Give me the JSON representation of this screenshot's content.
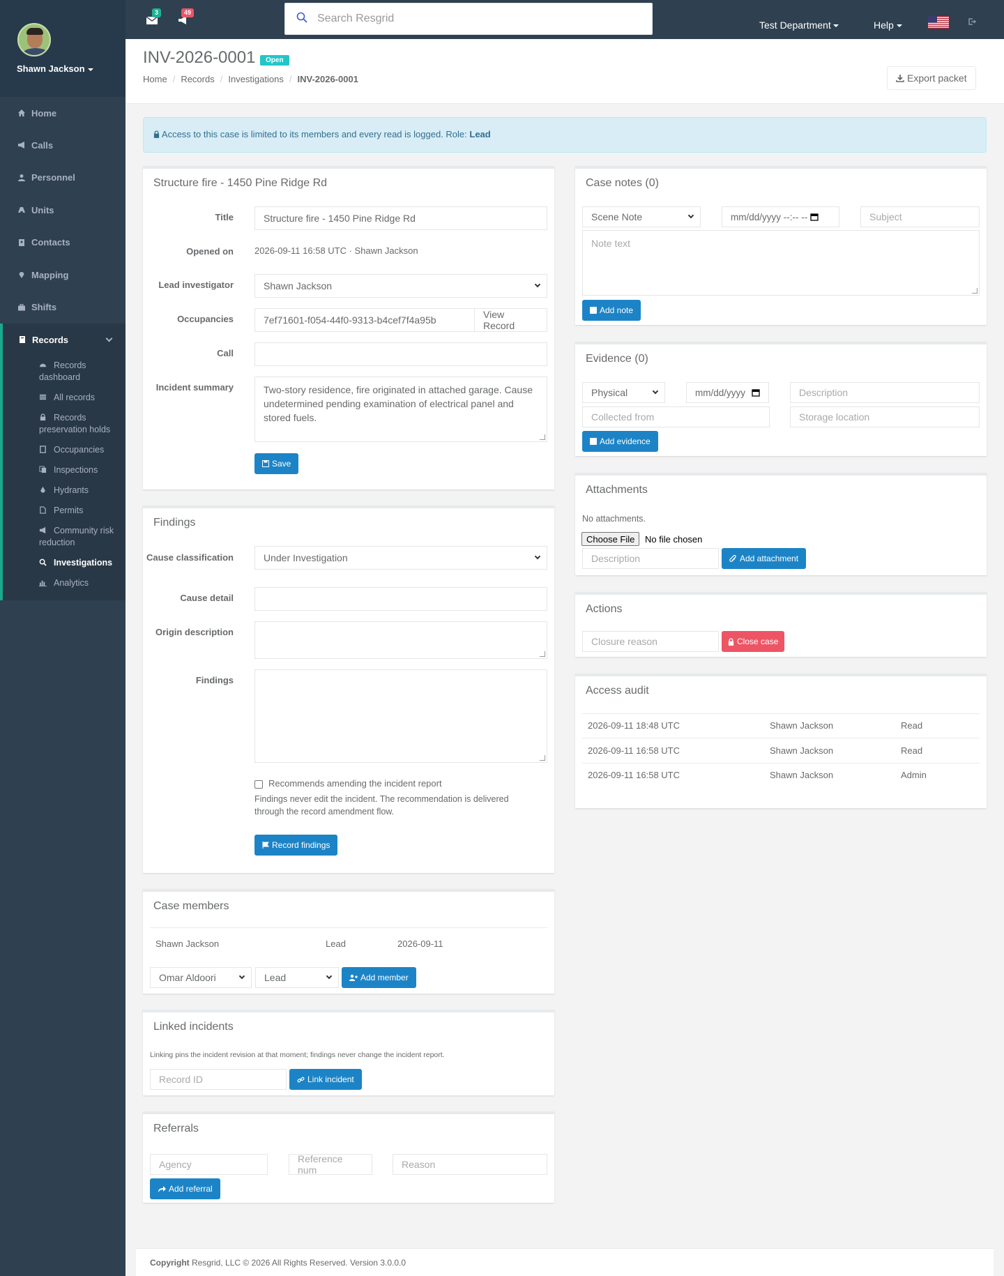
{
  "sidebar": {
    "user_name": "Shawn Jackson",
    "nav": [
      {
        "label": "Home",
        "icon": "home-icon"
      },
      {
        "label": "Calls",
        "icon": "bullhorn-icon"
      },
      {
        "label": "Personnel",
        "icon": "user-icon"
      },
      {
        "label": "Units",
        "icon": "truck-icon"
      },
      {
        "label": "Contacts",
        "icon": "address-book-icon"
      },
      {
        "label": "Mapping",
        "icon": "map-marker-icon"
      },
      {
        "label": "Shifts",
        "icon": "briefcase-icon"
      }
    ],
    "records": {
      "label": "Records",
      "items": [
        {
          "label": "Records dashboard"
        },
        {
          "label": "All records"
        },
        {
          "label": "Records preservation holds"
        },
        {
          "label": "Occupancies"
        },
        {
          "label": "Inspections"
        },
        {
          "label": "Hydrants"
        },
        {
          "label": "Permits"
        },
        {
          "label": "Community risk reduction"
        },
        {
          "label": "Investigations"
        },
        {
          "label": "Analytics"
        }
      ]
    }
  },
  "topbar": {
    "messages_count": "3",
    "notifications_count": "49",
    "search_placeholder": "Search Resgrid",
    "department": "Test Department",
    "help": "Help"
  },
  "heading": {
    "title": "INV-2026-0001",
    "status": "Open",
    "breadcrumb": [
      "Home",
      "Records",
      "Investigations",
      "INV-2026-0001"
    ],
    "export_label": "Export packet"
  },
  "alert": {
    "text": "Access to this case is limited to its members and every read is logged. Role: ",
    "role": "Lead"
  },
  "details": {
    "heading": "Structure fire - 1450 Pine Ridge Rd",
    "title_label": "Title",
    "title_value": "Structure fire - 1450 Pine Ridge Rd",
    "opened_label": "Opened on",
    "opened_value": "2026-09-11 16:58 UTC · Shawn Jackson",
    "lead_label": "Lead investigator",
    "lead_value": "Shawn Jackson",
    "occupancies_label": "Occupancies",
    "occupancies_value": "7ef71601-f054-44f0-9313-b4cef7f4a95b",
    "view_record": "View Record",
    "call_label": "Call",
    "call_value": "",
    "summary_label": "Incident summary",
    "summary_value": "Two-story residence, fire originated in attached garage. Cause undetermined pending examination of electrical panel and stored fuels.",
    "save_label": "Save"
  },
  "findings": {
    "heading": "Findings",
    "cause_class_label": "Cause classification",
    "cause_class_value": "Under Investigation",
    "cause_detail_label": "Cause detail",
    "origin_label": "Origin description",
    "findings_label": "Findings",
    "recommend_label": "Recommends amending the incident report",
    "recommend_help": "Findings never edit the incident. The recommendation is delivered through the record amendment flow.",
    "record_label": "Record findings"
  },
  "members": {
    "heading": "Case members",
    "rows": [
      {
        "name": "Shawn Jackson",
        "role": "Lead",
        "date": "2026-09-11"
      }
    ],
    "person_select": "Omar Aldoori",
    "role_select": "Lead",
    "add_label": "Add member"
  },
  "linked": {
    "heading": "Linked incidents",
    "help": "Linking pins the incident revision at that moment; findings never change the incident report.",
    "record_placeholder": "Record ID",
    "link_label": "Link incident"
  },
  "referrals": {
    "heading": "Referrals",
    "agency_placeholder": "Agency",
    "reference_placeholder": "Reference num",
    "reason_placeholder": "Reason",
    "add_label": "Add referral"
  },
  "notes": {
    "heading": "Case notes (0)",
    "type_value": "Scene Note",
    "datetime_placeholder": "mm/dd/yyyy --:-- --",
    "subject_placeholder": "Subject",
    "text_placeholder": "Note text",
    "add_label": "Add note"
  },
  "evidence": {
    "heading": "Evidence (0)",
    "type_value": "Physical",
    "date_placeholder": "mm/dd/yyyy",
    "description_placeholder": "Description",
    "collected_placeholder": "Collected from",
    "storage_placeholder": "Storage location",
    "add_label": "Add evidence"
  },
  "attachments": {
    "heading": "Attachments",
    "empty": "No attachments.",
    "choose_file": "Choose File",
    "no_file": "No file chosen",
    "description_placeholder": "Description",
    "add_label": "Add attachment"
  },
  "actions": {
    "heading": "Actions",
    "closure_placeholder": "Closure reason",
    "close_label": "Close case"
  },
  "audit": {
    "heading": "Access audit",
    "rows": [
      {
        "time": "2026-09-11 18:48 UTC",
        "user": "Shawn Jackson",
        "action": "Read"
      },
      {
        "time": "2026-09-11 16:58 UTC",
        "user": "Shawn Jackson",
        "action": "Read"
      },
      {
        "time": "2026-09-11 16:58 UTC",
        "user": "Shawn Jackson",
        "action": "Admin"
      }
    ]
  },
  "footer": {
    "copyright": "Copyright",
    "text": " Resgrid, LLC © 2026 All Rights Reserved.",
    "version": " Version 3.0.0.0"
  }
}
